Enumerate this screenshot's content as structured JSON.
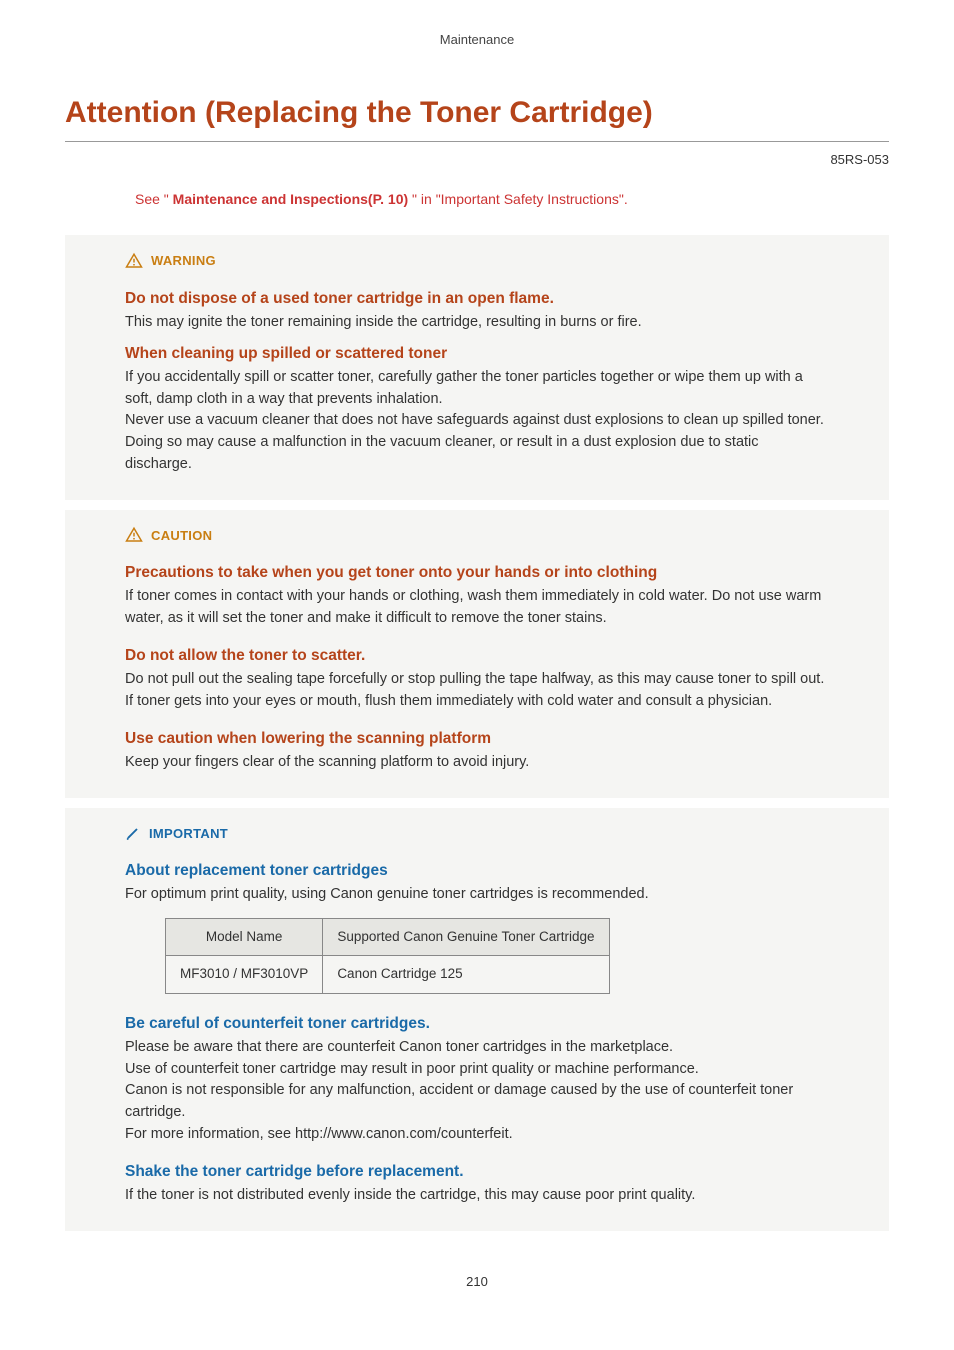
{
  "header": {
    "category": "Maintenance",
    "title": "Attention (Replacing the Toner Cartridge)",
    "doc_code": "85RS-053"
  },
  "see_line": {
    "prefix": "See \" ",
    "link": "Maintenance and Inspections(P. 10)",
    "suffix": " \" in \"Important Safety Instructions\"."
  },
  "warning": {
    "label": "WARNING",
    "sections": [
      {
        "heading": "Do not dispose of a used toner cartridge in an open flame.",
        "body": "This may ignite the toner remaining inside the cartridge, resulting in burns or fire."
      },
      {
        "heading": "When cleaning up spilled or scattered toner",
        "body": "If you accidentally spill or scatter toner, carefully gather the toner particles together or wipe them up with a soft, damp cloth in a way that prevents inhalation.\nNever use a vacuum cleaner that does not have safeguards against dust explosions to clean up spilled toner. Doing so may cause a malfunction in the vacuum cleaner, or result in a dust explosion due to static discharge."
      }
    ]
  },
  "caution": {
    "label": "CAUTION",
    "sections": [
      {
        "heading": "Precautions to take when you get toner onto your hands or into clothing",
        "body": "If toner comes in contact with your hands or clothing, wash them immediately in cold water. Do not use warm water, as it will set the toner and make it difficult to remove the toner stains."
      },
      {
        "heading": "Do not allow the toner to scatter.",
        "body": "Do not pull out the sealing tape forcefully or stop pulling the tape halfway, as this may cause toner to spill out. If toner gets into your eyes or mouth, flush them immediately with cold water and consult a physician."
      },
      {
        "heading": "Use caution when lowering the scanning platform",
        "body": "Keep your fingers clear of the scanning platform to avoid injury."
      }
    ]
  },
  "important": {
    "label": "IMPORTANT",
    "sec1": {
      "heading": "About replacement toner cartridges",
      "body": "For optimum print quality, using Canon genuine toner cartridges is recommended."
    },
    "table": {
      "headers": [
        "Model Name",
        "Supported Canon Genuine Toner Cartridge"
      ],
      "row": [
        "MF3010 / MF3010VP",
        "Canon Cartridge 125"
      ]
    },
    "sec2": {
      "heading": "Be careful of counterfeit toner cartridges.",
      "body": "Please be aware that there are counterfeit Canon toner cartridges in the marketplace.\nUse of counterfeit toner cartridge may result in poor print quality or machine performance.\nCanon is not responsible for any malfunction, accident or damage caused by the use of counterfeit toner cartridge.\nFor more information, see http://www.canon.com/counterfeit."
    },
    "sec3": {
      "heading": "Shake the toner cartridge before replacement.",
      "body": "If the toner is not distributed evenly inside the cartridge, this may cause poor print quality."
    }
  },
  "page_number": "210"
}
